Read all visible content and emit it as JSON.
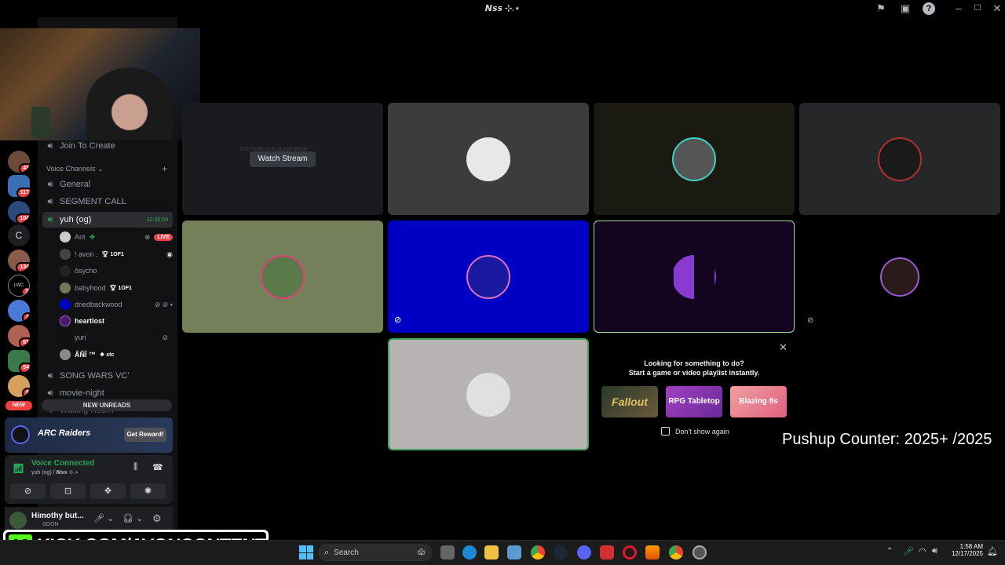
{
  "window": {
    "title": "𝙉𝙨𝙨 ⊹.⋆"
  },
  "servers": [
    {
      "badge": "43"
    },
    {
      "badge": "117"
    },
    {
      "badge": "104"
    },
    {
      "letter": "C"
    },
    {
      "badge": "134"
    },
    {
      "badge": "7",
      "text": "LWC"
    },
    {
      "badge": "3"
    },
    {
      "badge": "61"
    },
    {
      "badge": "54"
    },
    {
      "badge": "6"
    }
  ],
  "rail": {
    "new_label": "NEW"
  },
  "channels": {
    "join_to_create": "Join To Create",
    "voice_header": "Voice Channels",
    "general": "General",
    "segment_call": "SEGMENT CALL",
    "active": "yuh (og)",
    "active_timer": "32:35:59",
    "song_wars": "SONG WARS VC'",
    "movie_night": "movie-night",
    "waiting_room": "Waiting Room",
    "new_unreads": "NEW UNREADS"
  },
  "voice_users": [
    {
      "name": "Ant",
      "extra": "LIVE"
    },
    {
      "name": "! avon .",
      "tag": "1OF1"
    },
    {
      "name": "ôsycho"
    },
    {
      "name": "babyhood",
      "tag": "1OF1"
    },
    {
      "name": "driedbackwood"
    },
    {
      "name": "heartlost"
    },
    {
      "name": "yuri"
    },
    {
      "name": "ÂÑÎ ™",
      "tag": "xtc"
    }
  ],
  "promo": {
    "brand": "ARC Raiders",
    "button": "Get Reward!"
  },
  "voice_status": {
    "label": "Voice Connected",
    "sub": "yuh (og) / 𝙉𝙨𝙨 ⊹.⋆"
  },
  "user_panel": {
    "name": "Himothy but...",
    "status": "SOON"
  },
  "stage": {
    "watch_stream": "Watch Stream",
    "stream_overlay": "FORTNITE IS IN SLEEP MODE",
    "activity_title": "Looking for something to do?",
    "activity_sub": "Start a game or video playlist instantly.",
    "activity_cards": [
      "Fallout",
      "RPG Tabletop",
      "Blazing 8s"
    ],
    "dont_show": "Don't show again"
  },
  "overlay": {
    "pushup": "Pushup Counter: 2025+ /2025",
    "kick": "KICK.COM/AVONCONTENT"
  },
  "taskbar": {
    "search": "Search",
    "time": "1:58 AM",
    "date": "12/17/2025"
  },
  "colors": {
    "accent_green": "#23a55a",
    "live_red": "#ed4245",
    "tile_olive": "#74805a",
    "tile_blue": "#0000c4",
    "tile_purple": "#13051f",
    "tile_gray": "#b7b3b3"
  }
}
